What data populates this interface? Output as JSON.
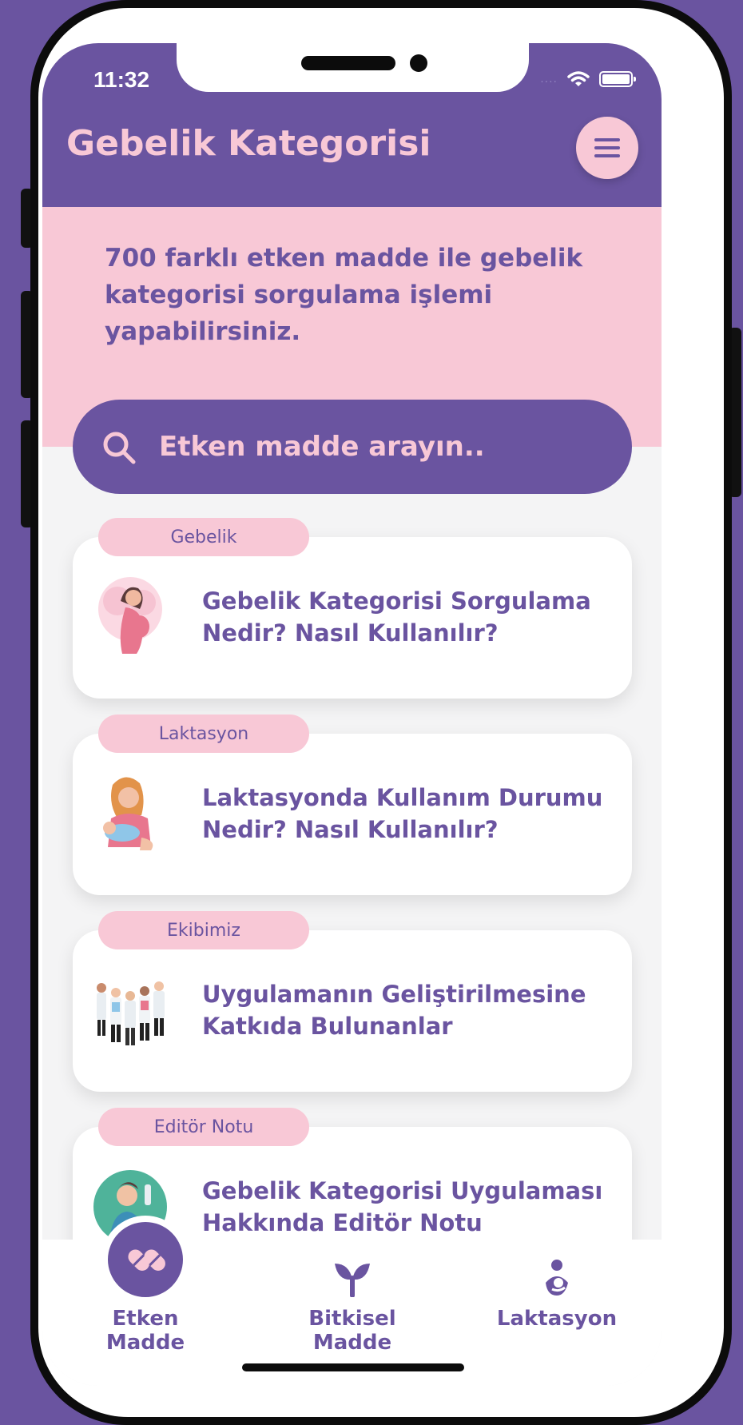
{
  "status_bar": {
    "time": "11:32",
    "signal": "....",
    "wifi_icon": "wifi-icon",
    "battery_icon": "battery-icon"
  },
  "header": {
    "title": "Gebelik Kategorisi",
    "menu_icon": "hamburger-menu-icon"
  },
  "intro": {
    "text": "700 farklı etken madde ile gebelik kategorisi sorgulama işlemi yapabilirsiniz."
  },
  "search": {
    "placeholder": "Etken madde arayın..",
    "icon": "search-icon"
  },
  "cards": [
    {
      "tag": "Gebelik",
      "title_line1": "Gebelik Kategorisi Sorgulama",
      "title_line2": "Nedir? Nasıl Kullanılır?",
      "illustration": "pregnant-woman-illustration"
    },
    {
      "tag": "Laktasyon",
      "title_line1": "Laktasyonda Kullanım Durumu",
      "title_line2": "Nedir? Nasıl Kullanılır?",
      "illustration": "breastfeeding-mother-illustration"
    },
    {
      "tag": "Ekibimiz",
      "title_line1": "Uygulamanın Geliştirilmesine",
      "title_line2": "Katkıda Bulunanlar",
      "illustration": "team-doctors-illustration"
    },
    {
      "tag": "Editör Notu",
      "title_line1": "Gebelik Kategorisi Uygulaması",
      "title_line2": "Hakkında Editör Notu",
      "illustration": "editor-doctor-illustration"
    }
  ],
  "bottom_nav": [
    {
      "label": "Etken Madde",
      "icon": "pill-capsule-icon",
      "active": true
    },
    {
      "label": "Bitkisel Madde",
      "icon": "plant-sprout-icon",
      "active": false
    },
    {
      "label": "Laktasyon",
      "icon": "mother-baby-icon",
      "active": false
    }
  ],
  "colors": {
    "primary": "#6a54a0",
    "accent_pink": "#f8c8d6",
    "background": "#f4f4f5",
    "card": "#ffffff"
  }
}
